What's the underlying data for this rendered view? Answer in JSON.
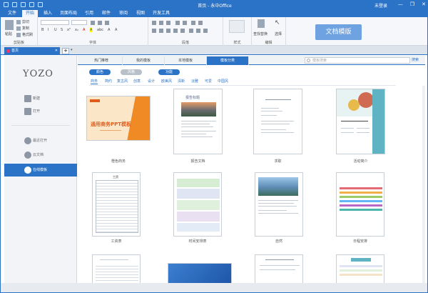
{
  "window": {
    "title": "首页 - 永中Office",
    "user": "未登录",
    "controls": [
      "—",
      "❐",
      "✕"
    ]
  },
  "menu": [
    "文件",
    "开始",
    "插入",
    "页面布局",
    "引用",
    "邮件",
    "审阅",
    "视图",
    "开发工具"
  ],
  "ribbon": {
    "groups": [
      {
        "label": "剪贴板"
      },
      {
        "label": "字体"
      },
      {
        "label": "段落"
      },
      {
        "label": "样式"
      },
      {
        "label": "编辑"
      }
    ],
    "clipboard": {
      "paste": "粘贴",
      "cut": "剪切",
      "copy": "复制",
      "format_painter": "格式刷"
    },
    "font_controls": [
      "B",
      "I",
      "U",
      "S",
      "x²",
      "x₂",
      "A",
      "A",
      "abc",
      "A",
      "A"
    ],
    "edit": {
      "find_replace": "查找替换",
      "select": "选择"
    },
    "banner": "文档模版"
  },
  "doc_tab": {
    "title": "首页",
    "close": "✕"
  },
  "sidebar": {
    "logo": "YOZO",
    "items": [
      {
        "label": "新建",
        "icon": "new-icon"
      },
      {
        "label": "打开",
        "icon": "folder-icon"
      },
      {
        "label": "最近打开",
        "icon": "clock-icon"
      },
      {
        "label": "云文档",
        "icon": "cloud-icon"
      },
      {
        "label": "在线模板",
        "icon": "template-icon",
        "active": true
      }
    ]
  },
  "content_tabs": [
    "热门推荐",
    "我的模板",
    "本地模板",
    "模板分类"
  ],
  "search": {
    "placeholder": "模板搜索",
    "button": "搜索"
  },
  "filters": [
    "颜色",
    "风格",
    "功能"
  ],
  "categories": [
    "商务",
    "简约",
    "复古风",
    "创意",
    "设计",
    "欧美风",
    "清新",
    "淡雅",
    "可爱",
    "中国风"
  ],
  "templates": [
    {
      "name": "橙色商务",
      "title": "通用商务PPT模板"
    },
    {
      "name": "报告文档",
      "title": "报告标题"
    },
    {
      "name": "求职"
    },
    {
      "name": "活动简介"
    },
    {
      "name": "工资表",
      "title": "工资"
    },
    {
      "name": "时间安排表"
    },
    {
      "name": "自然"
    },
    {
      "name": "日程安排"
    },
    {
      "name": ""
    },
    {
      "name": ""
    },
    {
      "name": ""
    },
    {
      "name": ""
    }
  ],
  "colors": {
    "accent": "#2b73c7",
    "orange": "#f08a24",
    "banner": "#6fa2e0"
  }
}
